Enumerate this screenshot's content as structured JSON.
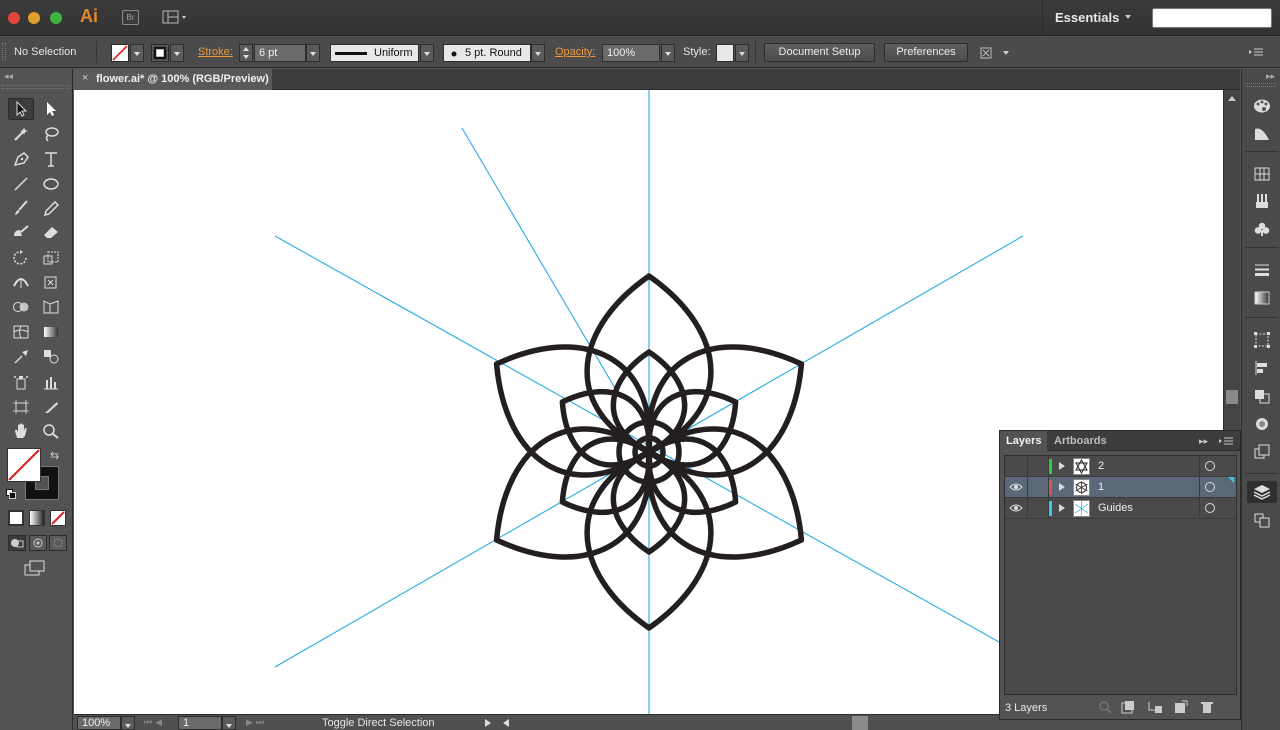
{
  "app": {
    "logo": "Ai",
    "bridge_label": "Br",
    "workspace": "Essentials",
    "search_placeholder": ""
  },
  "control_bar": {
    "selection_status": "No Selection",
    "stroke_label": "Stroke:",
    "stroke_weight": "6 pt",
    "variable_width_profile": "Uniform",
    "brush_definition": "5 pt. Round",
    "opacity_label": "Opacity:",
    "opacity_value": "100%",
    "style_label": "Style:",
    "document_setup_label": "Document Setup",
    "preferences_label": "Preferences"
  },
  "document_tab": {
    "close_glyph": "×",
    "title": "flower.ai* @ 100% (RGB/Preview)"
  },
  "status_bar": {
    "zoom": "100%",
    "artboard_number": "1",
    "status_text": "Toggle Direct Selection"
  },
  "layers_panel": {
    "tabs": [
      "Layers",
      "Artboards"
    ],
    "layers": [
      {
        "name": "2",
        "color": "#2ecc40",
        "visible": false,
        "selected": false
      },
      {
        "name": "1",
        "color": "#e05050",
        "visible": true,
        "selected": true
      },
      {
        "name": "Guides",
        "color": "#3ec6e8",
        "visible": true,
        "selected": false
      }
    ],
    "layer_count": "3 Layers"
  },
  "colors": {
    "guide": "#29abe2",
    "artwork_stroke": "#231f20",
    "accent_orange": "#ef9a3b"
  }
}
